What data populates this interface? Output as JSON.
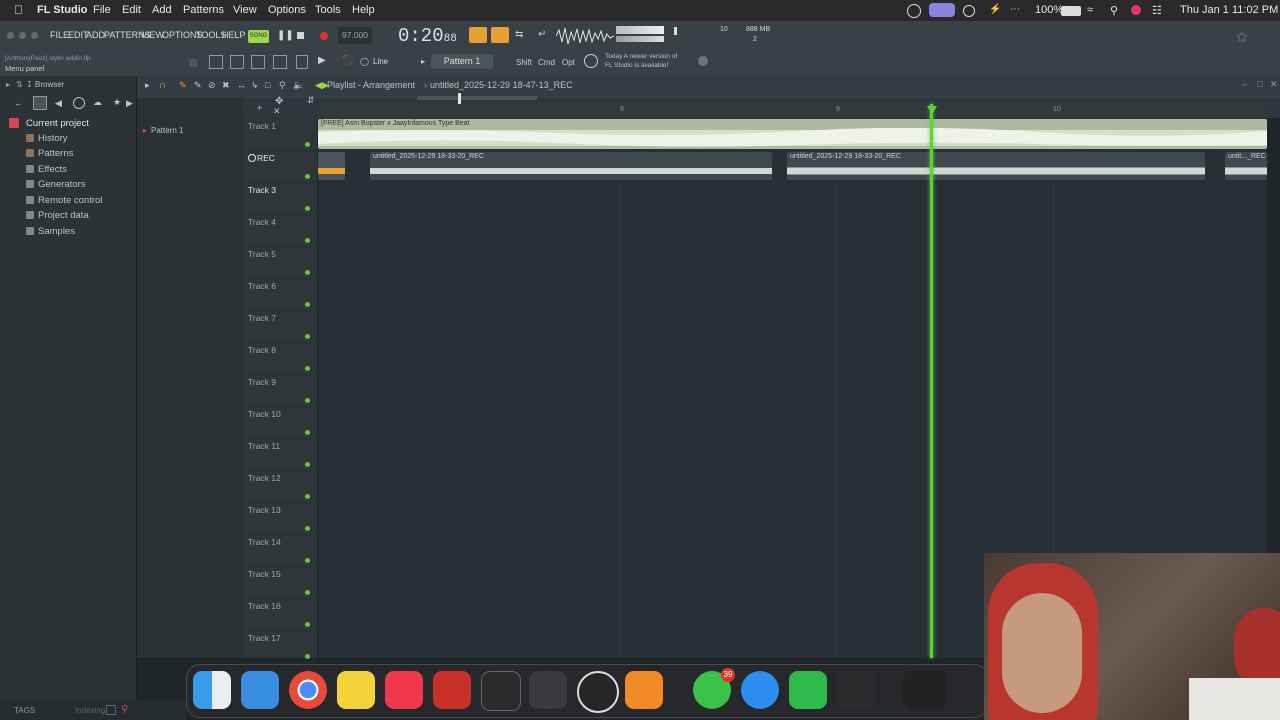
{
  "macbar": {
    "app_name": "FL Studio",
    "menus": [
      "File",
      "Edit",
      "Add",
      "Patterns",
      "View",
      "Options",
      "Tools",
      "Help"
    ],
    "battery": "100%",
    "clock": "Thu Jan 1  11:02 PM"
  },
  "fl": {
    "menus": [
      "FILE",
      "EDIT",
      "ADD",
      "PATTERNS",
      "VIEW",
      "OPTIONS",
      "TOOLS",
      "HELP"
    ],
    "mode": "SONG",
    "tempo": "97.000",
    "time": "0:20",
    "time_small": "88",
    "meter_top": "10",
    "meter_bottom": "2",
    "memory": "888 MB",
    "project_user": "[AnthonyPaez] stylin wildin.flp",
    "hint": "Menu panel",
    "snap": "Line",
    "pattern": "Pattern 1",
    "keys": [
      "Shift",
      "Cmd",
      "Opt"
    ],
    "news_line1": "Today  A newer version of",
    "news_line2": "FL Studio is available!"
  },
  "browser": {
    "title": "Browser",
    "items": [
      "Current project",
      "History",
      "Patterns",
      "Effects",
      "Generators",
      "Remote control",
      "Project data",
      "Samples"
    ],
    "tags_label": "TAGS",
    "indexing": "Indexing"
  },
  "picker": {
    "items": [
      "Pattern 1"
    ]
  },
  "playlist": {
    "title": "Playlist - Arrangement",
    "project": "untitled_2025-12-29 18-47-13_REC",
    "ruler": [
      "8",
      "9",
      "10"
    ],
    "tracks": [
      "Track 1",
      "REC",
      "Track 3",
      "Track 4",
      "Track 5",
      "Track 6",
      "Track 7",
      "Track 8",
      "Track 9",
      "Track 10",
      "Track 11",
      "Track 12",
      "Track 13",
      "Track 14",
      "Track 15",
      "Track 16",
      "Track 17"
    ],
    "clips": [
      {
        "title": "[FREE] Asm Bopster x JaayInfamous Type Beat"
      },
      {
        "title": "untitled_2025-12-29 18-33-20_REC"
      },
      {
        "title": "untitled_2025-12-29 18-33-20_REC"
      },
      {
        "title": "untit..._REC"
      }
    ]
  },
  "dock": {
    "messages_badge": "39",
    "icons": [
      "finder-icon",
      "mail-icon",
      "chrome-icon",
      "notes-icon",
      "music-icon",
      "photobooth-icon",
      "unity-icon",
      "launchpad-icon",
      "obs-icon",
      "flstudio-icon",
      "messages-icon",
      "safari-icon",
      "phone-icon",
      "mixer-icon"
    ]
  },
  "colors": {
    "accent_green": "#5fd235",
    "clip_green": "#b8c3a8",
    "rec_red": "#e5332a"
  }
}
